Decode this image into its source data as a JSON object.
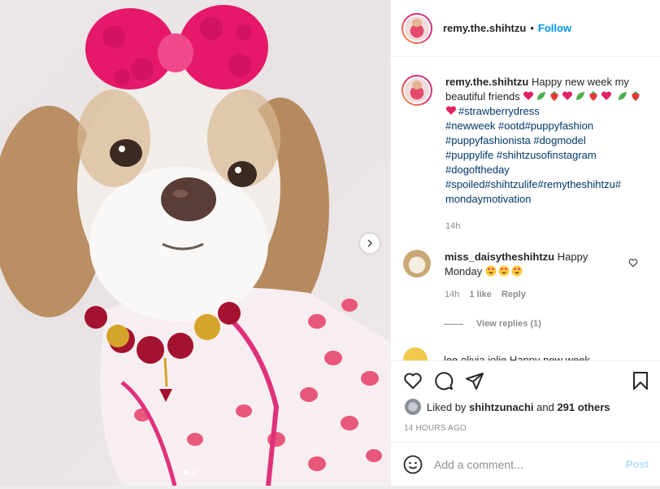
{
  "header": {
    "username": "remy.the.shihtzu",
    "separator": "•",
    "follow_label": "Follow"
  },
  "caption": {
    "username": "remy.the.shihtzu",
    "text": "Happy new week my beautiful friends",
    "hashtags_line1": "#strawberrydress",
    "hashtags_line2": "#newweek #ootd#puppyfashion",
    "hashtags_line3": "#puppyfashionista #dogmodel",
    "hashtags_line4": "#puppylife #shihtzusofinstagram",
    "hashtags_line5": "#dogoftheday",
    "hashtags_line6": "#spoiled#shihtzulife#remytheshihtzu#",
    "hashtags_line7": "mondaymotivation",
    "time": "14h"
  },
  "comments": [
    {
      "username": "miss_daisytheshihtzu",
      "text_a": "Happy",
      "text_b": "Monday",
      "time": "14h",
      "likes": "1 like",
      "reply": "Reply"
    }
  ],
  "view_replies": "View replies (1)",
  "partial_comment": "lee.olivia.jolie Happy new week",
  "likes": {
    "prefix": "Liked by",
    "user": "shihtzunachi",
    "joiner": "and",
    "others": "291 others"
  },
  "posted_ago": "14 HOURS AGO",
  "add_comment": {
    "placeholder": "Add a comment...",
    "post_label": "Post"
  },
  "icons": [
    "heart-icon",
    "comment-icon",
    "share-icon",
    "bookmark-icon",
    "emoji-icon",
    "chevron-right-icon"
  ],
  "colors": {
    "link": "#0095f6",
    "hashtag": "#00376b",
    "meta": "#8e8e8e",
    "post_disabled": "#b2dffc"
  }
}
